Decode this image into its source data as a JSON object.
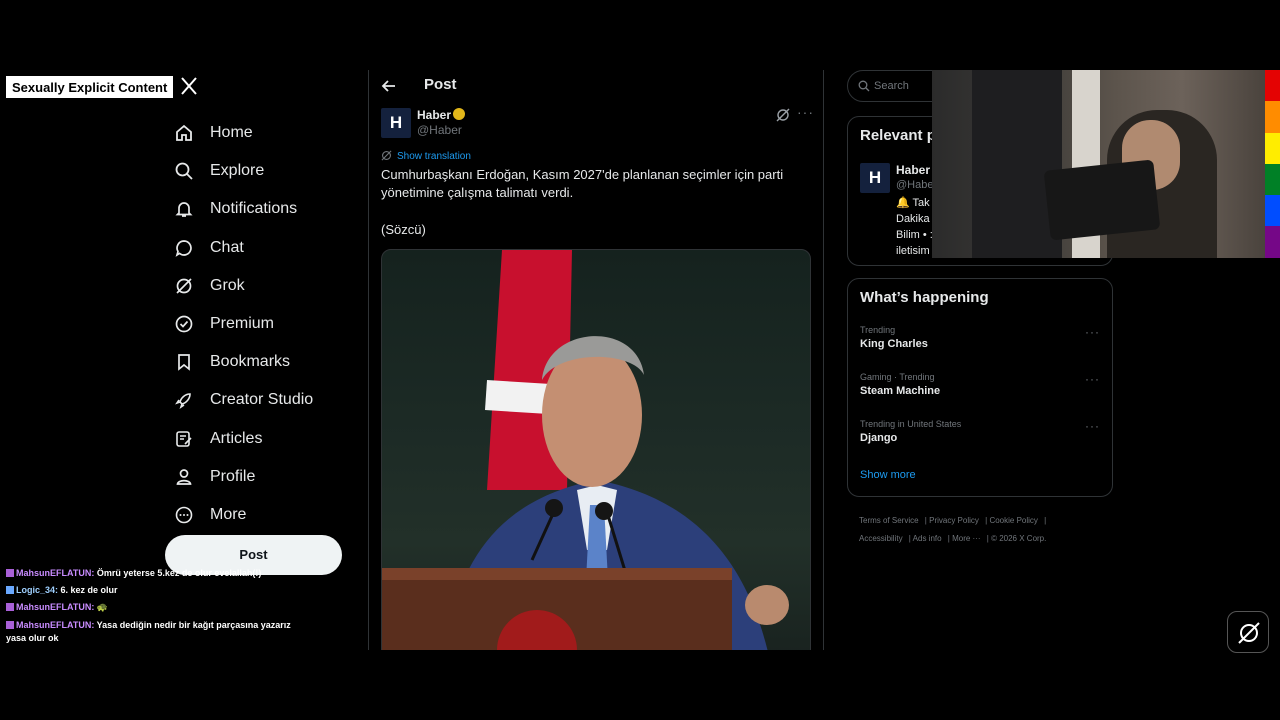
{
  "overlay": {
    "label": "Sexually Explicit Content"
  },
  "nav": {
    "items": [
      {
        "label": "Home",
        "icon": "home-icon"
      },
      {
        "label": "Explore",
        "icon": "search-icon"
      },
      {
        "label": "Notifications",
        "icon": "bell-icon"
      },
      {
        "label": "Chat",
        "icon": "chat-icon"
      },
      {
        "label": "Grok",
        "icon": "grok-icon"
      },
      {
        "label": "Premium",
        "icon": "premium-icon"
      },
      {
        "label": "Bookmarks",
        "icon": "bookmark-icon"
      },
      {
        "label": "Creator Studio",
        "icon": "rocket-icon"
      },
      {
        "label": "Articles",
        "icon": "articles-icon"
      },
      {
        "label": "Profile",
        "icon": "person-icon"
      },
      {
        "label": "More",
        "icon": "more-icon"
      }
    ],
    "post_label": "Post"
  },
  "chat": [
    {
      "nick": "MahsunEFLATUN:",
      "text": "Ömrü yeterse 5.kez de olur evelallah(!)"
    },
    {
      "nick": "Logic_34:",
      "text": "6. kez de olur"
    },
    {
      "nick": "MahsunEFLATUN:",
      "text": "🐢"
    },
    {
      "nick": "MahsunEFLATUN:",
      "text": "Yasa dediğin nedir bir kağıt parçasına yazarız yasa olur ok"
    }
  ],
  "post": {
    "header_title": "Post",
    "author_name": "Haber",
    "author_handle": "@Haber",
    "avatar_letter": "H",
    "show_translation": "Show translation",
    "text": "Cumhurbaşkanı Erdoğan, Kasım 2027'de planlanan seçimler için parti yönetimine çalışma talimatı verdi.",
    "source": "(Sözcü)"
  },
  "right": {
    "search_placeholder": "Search",
    "relevant": {
      "title": "Relevant p",
      "name": "Haber",
      "handle": "@Habe",
      "bio_line1": "🔔 Tak",
      "bio_line2": "Dakika",
      "bio_line3": "Bilim • :",
      "bio_line4": "iletisim"
    },
    "happening": {
      "title": "What’s happening",
      "trends": [
        {
          "category": "Trending",
          "name": "King Charles"
        },
        {
          "category": "Gaming · Trending",
          "name": "Steam Machine"
        },
        {
          "category": "Trending in United States",
          "name": "Django"
        }
      ],
      "show_more": "Show more"
    },
    "footer": {
      "terms": "Terms of Service",
      "privacy": "Privacy Policy",
      "cookie": "Cookie Policy",
      "accessibility": "Accessibility",
      "ads": "Ads info",
      "more": "More ···",
      "copyright": "© 2026 X Corp."
    }
  },
  "colors": {
    "accent": "#1d9bf0",
    "background": "#000000",
    "rainbow": [
      "#e40303",
      "#ff8c00",
      "#ffed00",
      "#008026",
      "#004dff",
      "#750787"
    ]
  }
}
